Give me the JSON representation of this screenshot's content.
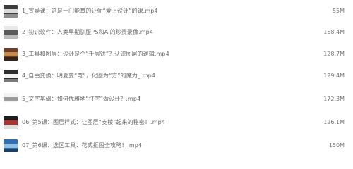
{
  "files": [
    {
      "name": "1_宣导课：这是一门能真的让你“爱上设计”的课.mp4",
      "size": "55M",
      "thumb_icon": "video-thumbnail-icon",
      "thumb_colors": [
        "#3b3b3b",
        "#d9d9d9",
        "#8f8f8f"
      ]
    },
    {
      "name": "2_初识软件：人类早期驯服PS和AI的珍贵录像.mp4",
      "size": "168.4M",
      "thumb_icon": "video-thumbnail-icon",
      "thumb_colors": [
        "#e8e8e8",
        "#5a5a5a",
        "#b8b8b8"
      ]
    },
    {
      "name": "3_工具和图层：设计是个“千层饼”？认识图层的逻辑.mp4",
      "size": "128.7M",
      "thumb_icon": "video-thumbnail-icon",
      "thumb_colors": [
        "#6b3f2a",
        "#c48a4a",
        "#3a2418"
      ]
    },
    {
      "name": "4_自由变换：明夏变“弯”，化圆为“方”的魔力_.mp4",
      "size": "129.4M",
      "thumb_icon": "video-thumbnail-icon",
      "thumb_colors": [
        "#2d2d2d",
        "#f0f0f0",
        "#7a7a7a"
      ]
    },
    {
      "name": "5_文字基础：如何优雅地“打字”做设计？.mp4",
      "size": "172.3M",
      "thumb_icon": "video-thumbnail-icon",
      "thumb_colors": [
        "#f2f2f2",
        "#9c9c9c",
        "#ffffff"
      ]
    },
    {
      "name": "06_第5课：图层样式：让图层“支棱”起来的秘密！.mp4",
      "size": "126.1M",
      "thumb_icon": "video-thumbnail-icon",
      "thumb_colors": [
        "#1e1e1e",
        "#b03030",
        "#dcdcdc"
      ]
    },
    {
      "name": "07_第6课：选区工具：花式抠图全攻略！.mp4",
      "size": "150M",
      "thumb_icon": "video-thumbnail-icon",
      "thumb_colors": [
        "#2f6fb0",
        "#8fc0e8",
        "#1c3f66"
      ]
    }
  ]
}
